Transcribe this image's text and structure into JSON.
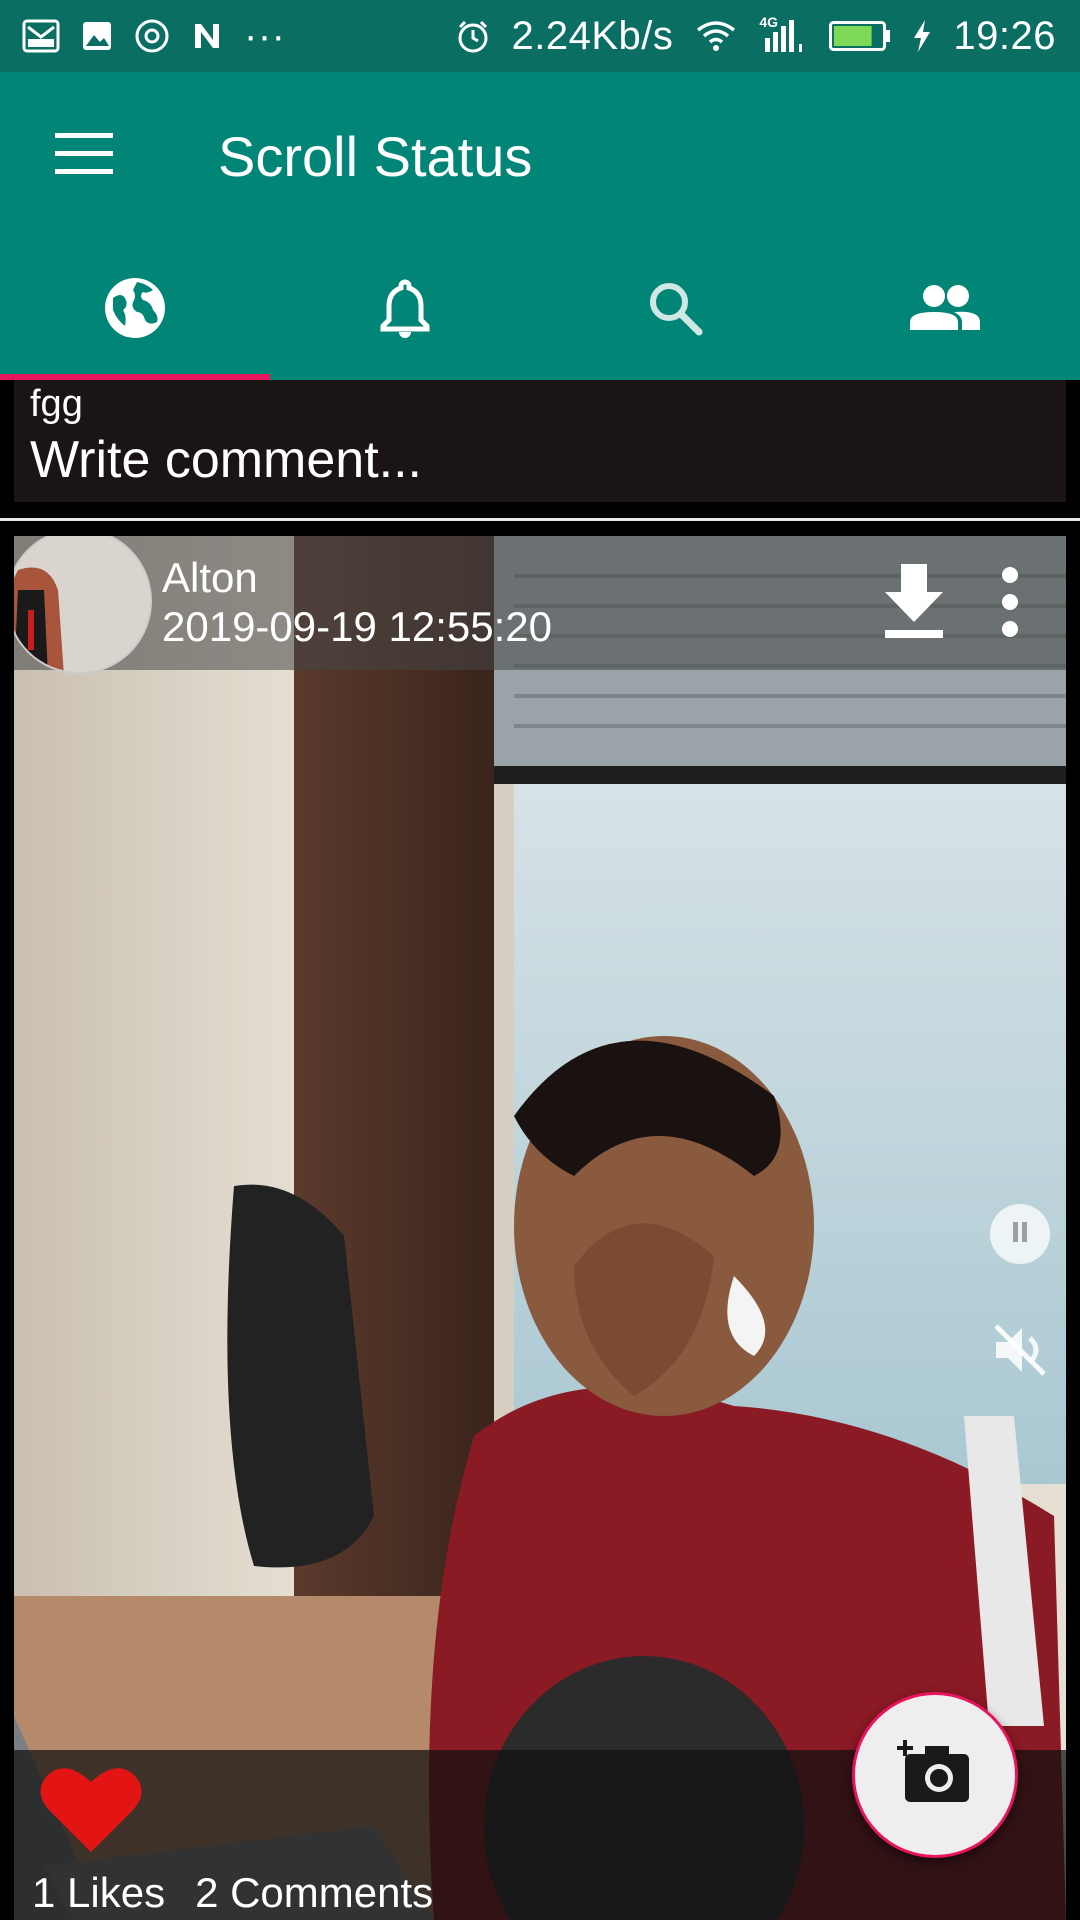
{
  "status_bar": {
    "network_speed": "2.24Kb/s",
    "network_type": "4G",
    "time": "19:26",
    "battery_percent": 80,
    "left_icons": [
      "mail-icon",
      "image-icon",
      "at-icon",
      "n-icon"
    ],
    "right_icons": [
      "alarm-icon",
      "wifi-icon",
      "signal-icon",
      "battery-icon",
      "charging-icon"
    ]
  },
  "app_bar": {
    "title": "Scroll Status",
    "menu_icon": "hamburger-menu-icon"
  },
  "tabs": [
    {
      "name": "global",
      "icon": "globe-icon",
      "active": true
    },
    {
      "name": "notifications",
      "icon": "bell-icon",
      "active": false
    },
    {
      "name": "search",
      "icon": "search-icon",
      "active": false
    },
    {
      "name": "people",
      "icon": "people-icon",
      "active": false
    }
  ],
  "previous_post": {
    "comment_text": "fgg",
    "comment_placeholder": "Write comment..."
  },
  "post": {
    "username": "Alton",
    "timestamp": "2019-09-19 12:55:20",
    "likes": "1 Likes",
    "comments": "2 Comments"
  },
  "colors": {
    "primary": "#008577",
    "primary_dark": "#0a6e63",
    "accent": "#e8145c",
    "like_red": "#e31414"
  }
}
